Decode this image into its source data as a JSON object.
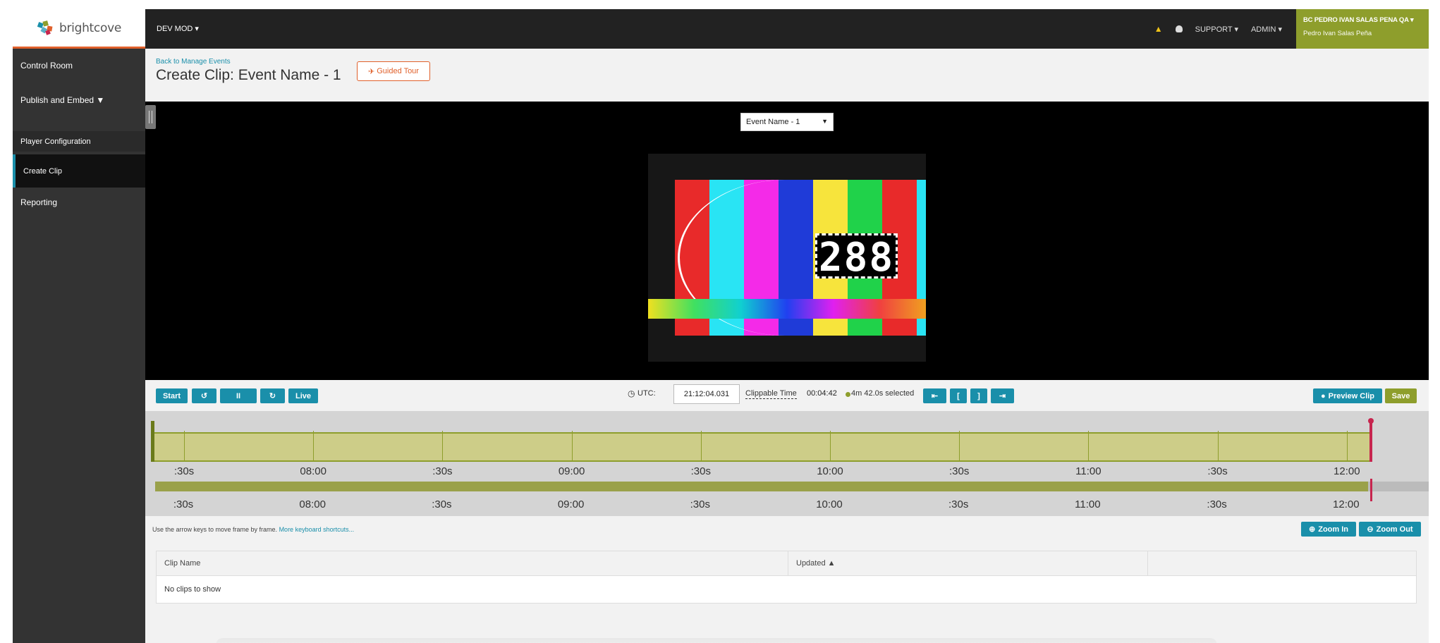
{
  "brand": {
    "logo_text": "brightcove"
  },
  "topbar": {
    "dev_mod": "DEV MOD ▾",
    "support": "SUPPORT ▾",
    "admin": "ADMIN ▾",
    "account_name": "BC PEDRO IVAN SALAS PENA QA ▾",
    "account_user": "Pedro Ivan Salas Peña"
  },
  "sidebar": {
    "items": [
      {
        "label": "Control Room"
      },
      {
        "label": "Publish and Embed  ▼"
      },
      {
        "label": "Player Configuration"
      },
      {
        "label": "Create Clip"
      },
      {
        "label": "Reporting"
      }
    ]
  },
  "header": {
    "back_link": "Back to Manage Events",
    "title": "Create Clip: Event Name - 1",
    "guided_tour": "Guided Tour"
  },
  "player": {
    "event_select": "Event Name - 1",
    "counter": "288"
  },
  "controls": {
    "start": "Start",
    "rewind": "↺",
    "pause": "II",
    "forward": "↻",
    "live": "Live",
    "utc_label": "UTC:",
    "utc_value": "21:12:04.031",
    "clippable_label": "Clippable Time",
    "clippable_value": "00:04:42",
    "selected": "4m 42.0s selected",
    "nav_first": "⇤",
    "nav_in": "[",
    "nav_out": "]",
    "nav_last": "⇥",
    "preview_clip": "Preview Clip",
    "save": "Save"
  },
  "timeline": {
    "labels": [
      ":30s",
      "08:00",
      ":30s",
      "09:00",
      ":30s",
      "10:00",
      ":30s",
      "11:00",
      ":30s",
      "12:00"
    ],
    "selection_fraction": 0.95
  },
  "hint": {
    "text": "Use the arrow keys to move frame by frame. ",
    "link": "More keyboard shortcuts..."
  },
  "zoom": {
    "zoom_in": "Zoom In",
    "zoom_out": "Zoom Out"
  },
  "table": {
    "columns": [
      "Clip Name",
      "Updated ▲",
      ""
    ],
    "empty": "No clips to show"
  },
  "colors": {
    "accent": "#1a8faa",
    "brand_green": "#8e9e2c",
    "orange": "#e0602b",
    "playhead": "#c7254e"
  }
}
